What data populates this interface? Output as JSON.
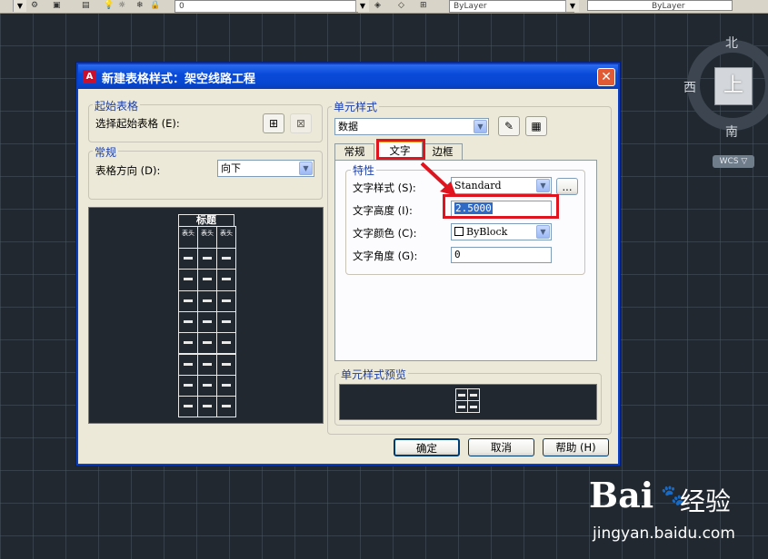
{
  "toolbar": {
    "layer_value": "0",
    "color_value": "ByLayer",
    "linetype_value": "ByLayer"
  },
  "viewcube": {
    "north": "北",
    "south": "南",
    "west": "西",
    "top_face": "上",
    "wcs": "WCS ▽"
  },
  "dialog": {
    "title": "新建表格样式：架空线路工程",
    "close_label": "✕",
    "start_table": {
      "group_title": "起始表格",
      "select_label": "选择起始表格 (E):"
    },
    "general": {
      "group_title": "常规",
      "direction_label": "表格方向 (D):",
      "direction_value": "向下"
    },
    "preview": {
      "title": "标题",
      "header_text": "表头"
    },
    "cell_style": {
      "group_title": "单元样式",
      "style_value": "数据",
      "tabs": [
        {
          "label": "常规"
        },
        {
          "label": "文字"
        },
        {
          "label": "边框"
        }
      ],
      "properties": {
        "group_title": "特性",
        "text_style_label": "文字样式 (S):",
        "text_style_value": "Standard",
        "ellipsis": "...",
        "text_height_label": "文字高度 (I):",
        "text_height_value": "2.5000",
        "text_color_label": "文字颜色 (C):",
        "text_color_value": "ByBlock",
        "text_angle_label": "文字角度 (G):",
        "text_angle_value": "0"
      },
      "preview_title": "单元样式预览"
    },
    "buttons": {
      "ok": "确定",
      "cancel": "取消",
      "help": "帮助 (H)"
    }
  },
  "watermark": {
    "brand": "Bai",
    "brand_suffix": "经验",
    "url": "jingyan.baidu.com"
  },
  "colors": {
    "title_bar": "#0a4ad9",
    "highlight": "#e0141e",
    "canvas": "#212830"
  }
}
